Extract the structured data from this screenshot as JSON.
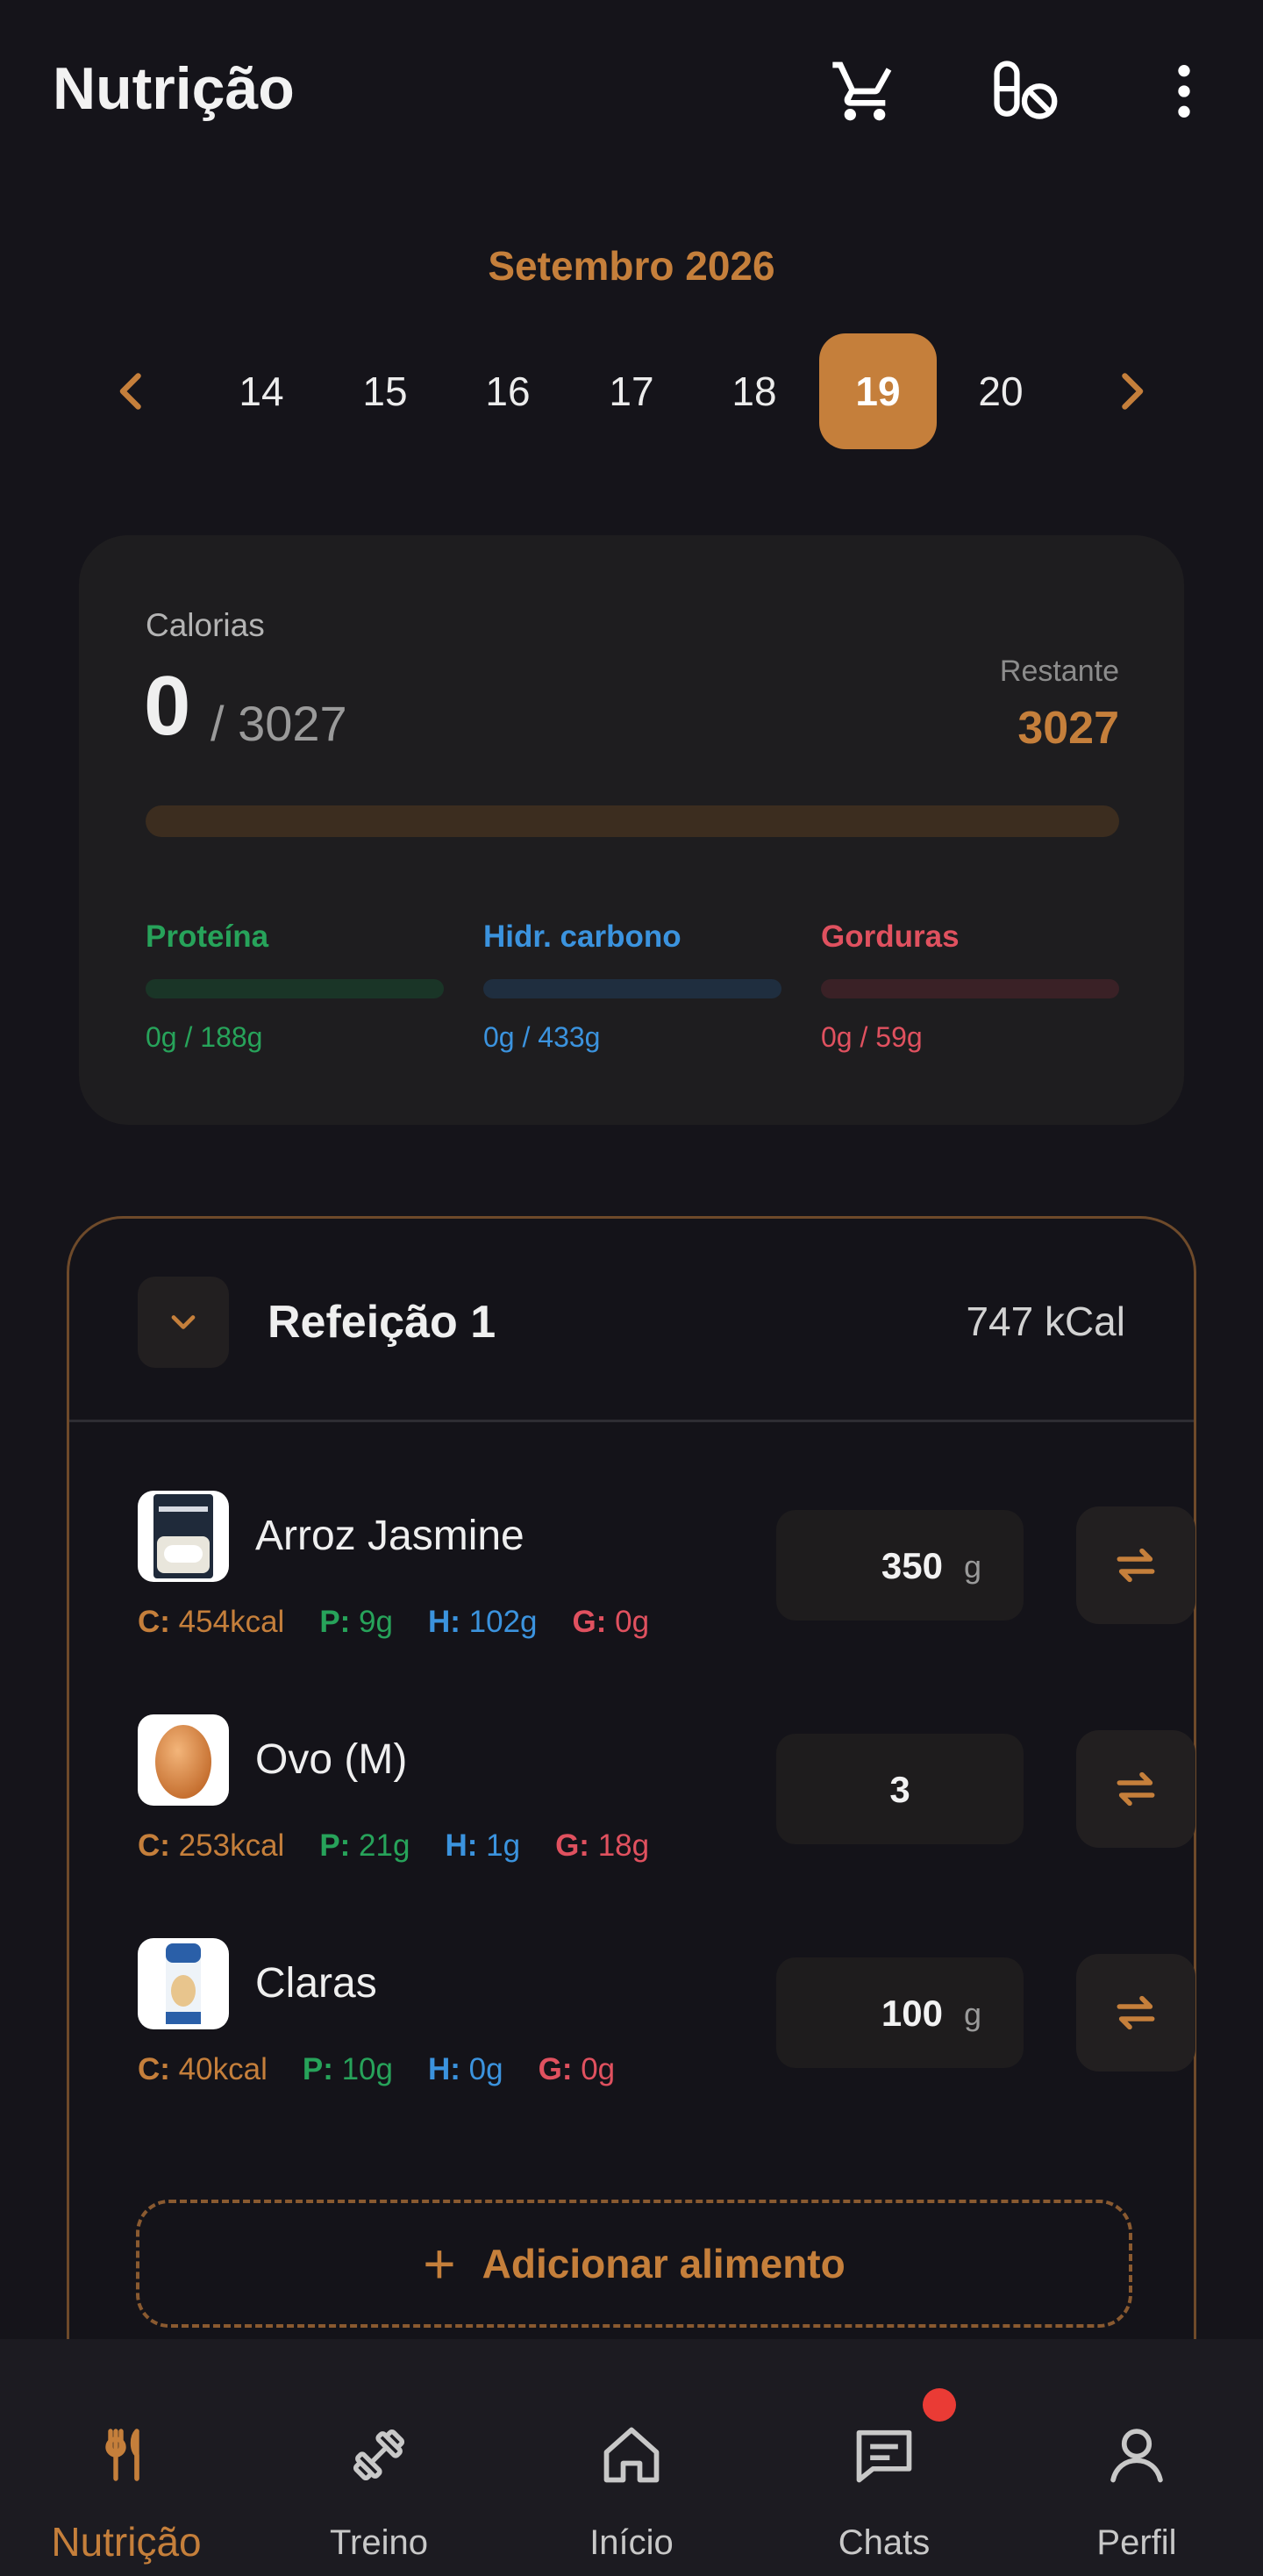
{
  "header": {
    "title": "Nutrição",
    "icons": [
      "cart-icon",
      "supplement-off-icon",
      "more-vertical-icon"
    ]
  },
  "calendar": {
    "month": "Setembro 2026",
    "days": [
      "14",
      "15",
      "16",
      "17",
      "18",
      "19",
      "20"
    ],
    "selected": "19"
  },
  "calories": {
    "label": "Calorias",
    "consumed": "0",
    "goal": "/ 3027",
    "remaining_label": "Restante",
    "remaining": "3027",
    "progress": 0,
    "macros": [
      {
        "name": "Proteína",
        "value": "0g / 188g",
        "progress": 0,
        "color": "#27a35a",
        "track": "#1a3527"
      },
      {
        "name": "Hidr. carbono",
        "value": "0g / 433g",
        "progress": 0,
        "color": "#3b93de",
        "track": "#1f2e3f"
      },
      {
        "name": "Gorduras",
        "value": "0g / 59g",
        "progress": 0,
        "color": "#e0515f",
        "track": "#3a2126"
      }
    ]
  },
  "meal": {
    "title": "Refeição 1",
    "kcal": "747 kCal",
    "foods": [
      {
        "name": "Arroz Jasmine",
        "qty": "350",
        "unit": "g",
        "c": "454kcal",
        "p": "9g",
        "h": "102g",
        "g": "0g"
      },
      {
        "name": "Ovo (M)",
        "qty": "3",
        "unit": "",
        "c": "253kcal",
        "p": "21g",
        "h": "1g",
        "g": "18g"
      },
      {
        "name": "Claras",
        "qty": "100",
        "unit": "g",
        "c": "40kcal",
        "p": "10g",
        "h": "0g",
        "g": "0g"
      }
    ],
    "macro_prefixes": {
      "c": "C:",
      "p": "P:",
      "h": "H:",
      "g": "G:"
    },
    "add_label": "Adicionar alimento"
  },
  "nav": {
    "items": [
      "Nutrição",
      "Treino",
      "Início",
      "Chats",
      "Perfil"
    ],
    "active": "Nutrição"
  },
  "colors": {
    "accent": "#c57f3b",
    "protein": "#27a35a",
    "carbs": "#3b93de",
    "fat": "#e0515f",
    "background": "#15141a"
  }
}
